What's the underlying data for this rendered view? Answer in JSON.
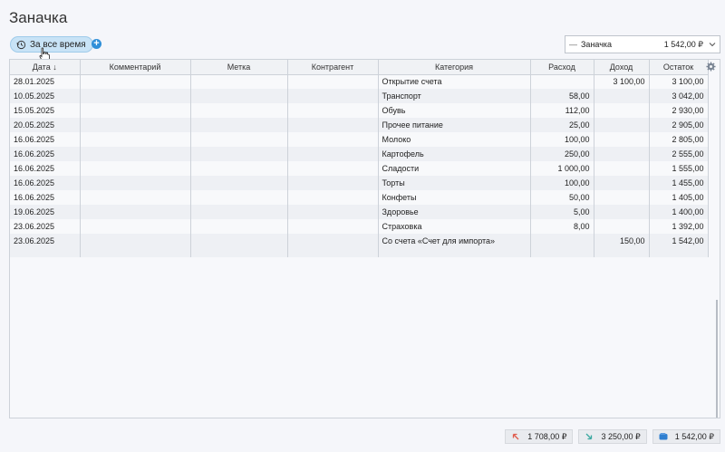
{
  "page": {
    "title": "Заначка"
  },
  "toolbar": {
    "period_label": "За все время"
  },
  "account": {
    "name": "Заначка",
    "balance": "1 542,00 ₽"
  },
  "table": {
    "columns": [
      "Дата ↓",
      "Комментарий",
      "Метка",
      "Контрагент",
      "Категория",
      "Расход",
      "Доход",
      "Остаток"
    ],
    "rows": [
      {
        "date": "28.01.2025",
        "comment": "",
        "tag": "",
        "payee": "",
        "category": "Открытие счета",
        "expense": "",
        "income": "3 100,00",
        "balance": "3 100,00"
      },
      {
        "date": "10.05.2025",
        "comment": "",
        "tag": "",
        "payee": "",
        "category": "Транспорт",
        "expense": "58,00",
        "income": "",
        "balance": "3 042,00"
      },
      {
        "date": "15.05.2025",
        "comment": "",
        "tag": "",
        "payee": "",
        "category": "Обувь",
        "expense": "112,00",
        "income": "",
        "balance": "2 930,00"
      },
      {
        "date": "20.05.2025",
        "comment": "",
        "tag": "",
        "payee": "",
        "category": "Прочее питание",
        "expense": "25,00",
        "income": "",
        "balance": "2 905,00"
      },
      {
        "date": "16.06.2025",
        "comment": "",
        "tag": "",
        "payee": "",
        "category": "Молоко",
        "expense": "100,00",
        "income": "",
        "balance": "2 805,00"
      },
      {
        "date": "16.06.2025",
        "comment": "",
        "tag": "",
        "payee": "",
        "category": "Картофель",
        "expense": "250,00",
        "income": "",
        "balance": "2 555,00"
      },
      {
        "date": "16.06.2025",
        "comment": "",
        "tag": "",
        "payee": "",
        "category": "Сладости",
        "expense": "1 000,00",
        "income": "",
        "balance": "1 555,00"
      },
      {
        "date": "16.06.2025",
        "comment": "",
        "tag": "",
        "payee": "",
        "category": "Торты",
        "expense": "100,00",
        "income": "",
        "balance": "1 455,00"
      },
      {
        "date": "16.06.2025",
        "comment": "",
        "tag": "",
        "payee": "",
        "category": "Конфеты",
        "expense": "50,00",
        "income": "",
        "balance": "1 405,00"
      },
      {
        "date": "19.06.2025",
        "comment": "",
        "tag": "",
        "payee": "",
        "category": "Здоровье",
        "expense": "5,00",
        "income": "",
        "balance": "1 400,00"
      },
      {
        "date": "23.06.2025",
        "comment": "",
        "tag": "",
        "payee": "",
        "category": "Страховка",
        "expense": "8,00",
        "income": "",
        "balance": "1 392,00"
      },
      {
        "date": "23.06.2025",
        "comment": "",
        "tag": "",
        "payee": "",
        "category": "Со счета «Счет для импорта»",
        "expense": "",
        "income": "150,00",
        "balance": "1 542,00"
      }
    ]
  },
  "totals": {
    "expense": "1 708,00 ₽",
    "income": "3 250,00 ₽",
    "balance": "1 542,00 ₽"
  },
  "colors": {
    "accent": "#2f8fd8",
    "period_bg": "#c8e3f6",
    "expense_icon": "#e05a4a",
    "income_icon": "#3aa8a0",
    "balance_icon": "#2f7fd0"
  },
  "icons": {
    "period": "history-icon",
    "add": "plus-icon",
    "settings": "gear-icon",
    "expense": "arrow-up-left-icon",
    "income": "arrow-down-right-icon",
    "balance": "wallet-icon"
  }
}
